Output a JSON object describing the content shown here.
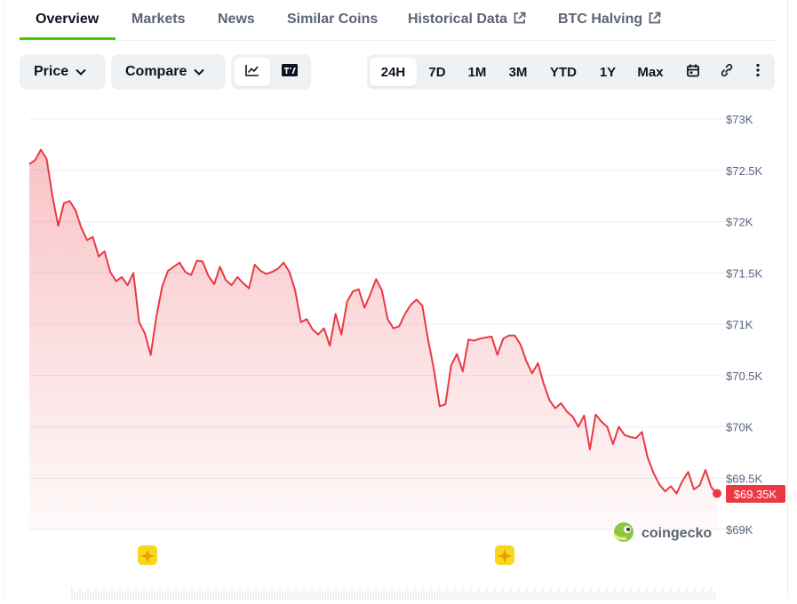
{
  "tabs": [
    {
      "label": "Overview",
      "active": true,
      "external": false
    },
    {
      "label": "Markets",
      "active": false,
      "external": false
    },
    {
      "label": "News",
      "active": false,
      "external": false
    },
    {
      "label": "Similar Coins",
      "active": false,
      "external": false
    },
    {
      "label": "Historical Data",
      "active": false,
      "external": true
    },
    {
      "label": "BTC Halving",
      "active": false,
      "external": true
    }
  ],
  "toolbar": {
    "price_label": "Price",
    "compare_label": "Compare",
    "view_icons": [
      "line-chart-icon",
      "tradingview-icon"
    ],
    "ranges": [
      "24H",
      "7D",
      "1M",
      "3M",
      "YTD",
      "1Y",
      "Max"
    ],
    "selected_range": "24H",
    "tool_icons": [
      "calendar-icon",
      "link-icon",
      "more-icon"
    ]
  },
  "colors": {
    "accent_green": "#4bcc00",
    "line_red": "#ea3943",
    "grid": "#eceef1"
  },
  "chart_data": {
    "type": "area",
    "ylim": [
      69000,
      73000
    ],
    "y_ticks": [
      "$69K",
      "$69.5K",
      "$70K",
      "$70.5K",
      "$71K",
      "$71.5K",
      "$72K",
      "$72.5K",
      "$73K"
    ],
    "y_tick_values": [
      69000,
      69500,
      70000,
      70500,
      71000,
      71500,
      72000,
      72500,
      73000
    ],
    "current_price_label": "$69.35K",
    "watermark": "coingecko",
    "event_markers": 2,
    "values": [
      72560,
      72600,
      72700,
      72610,
      72250,
      71960,
      72180,
      72200,
      72110,
      71940,
      71820,
      71850,
      71660,
      71710,
      71510,
      71420,
      71460,
      71380,
      71500,
      71020,
      70910,
      70700,
      71080,
      71370,
      71520,
      71560,
      71600,
      71510,
      71480,
      71620,
      71610,
      71470,
      71390,
      71560,
      71430,
      71380,
      71460,
      71400,
      71350,
      71580,
      71520,
      71490,
      71510,
      71540,
      71600,
      71510,
      71330,
      71020,
      71050,
      70950,
      70900,
      70960,
      70790,
      71100,
      70900,
      71220,
      71320,
      71340,
      71160,
      71290,
      71440,
      71330,
      71050,
      70960,
      70980,
      71100,
      71190,
      71240,
      71180,
      70850,
      70560,
      70200,
      70220,
      70600,
      70710,
      70540,
      70850,
      70840,
      70860,
      70870,
      70880,
      70700,
      70860,
      70890,
      70890,
      70800,
      70640,
      70520,
      70620,
      70420,
      70260,
      70180,
      70230,
      70150,
      70100,
      70000,
      70110,
      69780,
      70120,
      70050,
      70000,
      69830,
      70000,
      69920,
      69900,
      69890,
      69950,
      69700,
      69550,
      69440,
      69370,
      69420,
      69350,
      69470,
      69560,
      69390,
      69430,
      69580,
      69410,
      69350
    ]
  }
}
